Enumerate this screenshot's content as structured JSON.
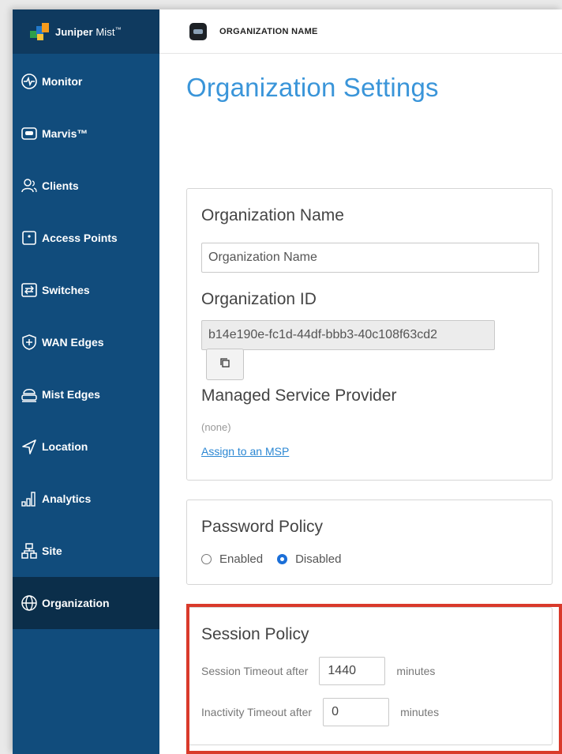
{
  "sidebar": {
    "brand": {
      "name_bold": "Juniper",
      "name_light": "Mist",
      "trademark": "™"
    },
    "items": [
      {
        "label": "Monitor",
        "icon": "monitor-icon"
      },
      {
        "label": "Marvis™",
        "icon": "marvis-icon"
      },
      {
        "label": "Clients",
        "icon": "clients-icon"
      },
      {
        "label": "Access Points",
        "icon": "access-point-icon"
      },
      {
        "label": "Switches",
        "icon": "switch-icon"
      },
      {
        "label": "WAN Edges",
        "icon": "wan-edge-icon"
      },
      {
        "label": "Mist Edges",
        "icon": "mist-edge-icon"
      },
      {
        "label": "Location",
        "icon": "location-icon"
      },
      {
        "label": "Analytics",
        "icon": "analytics-icon"
      },
      {
        "label": "Site",
        "icon": "site-icon"
      },
      {
        "label": "Organization",
        "icon": "organization-icon",
        "active": true
      }
    ],
    "colors": {
      "background": "#114c7c",
      "header": "#0f3a5f",
      "active": "#0b2e4a"
    }
  },
  "topbar": {
    "org_title": "ORGANIZATION NAME"
  },
  "main": {
    "page_title": "Organization Settings",
    "org_card": {
      "name_label": "Organization Name",
      "name_value": "Organization Name",
      "id_label": "Organization ID",
      "id_value": "b14e190e-fc1d-44df-bbb3-40c108f63cd2",
      "copy_icon": "copy-icon",
      "msp_label": "Managed Service Provider",
      "msp_value": "(none)",
      "msp_link": "Assign to an MSP"
    },
    "password_card": {
      "title": "Password Policy",
      "options": [
        {
          "label": "Enabled",
          "checked": false
        },
        {
          "label": "Disabled",
          "checked": true
        }
      ]
    },
    "session_card": {
      "title": "Session Policy",
      "session_timeout_label": "Session Timeout after",
      "session_timeout_value": "1440",
      "inactivity_timeout_label": "Inactivity Timeout after",
      "inactivity_timeout_value": "0",
      "unit": "minutes"
    }
  },
  "accent_colors": {
    "title_blue": "#3a95d9",
    "link_blue": "#2b87d3",
    "highlight_red": "#d93a2b"
  }
}
